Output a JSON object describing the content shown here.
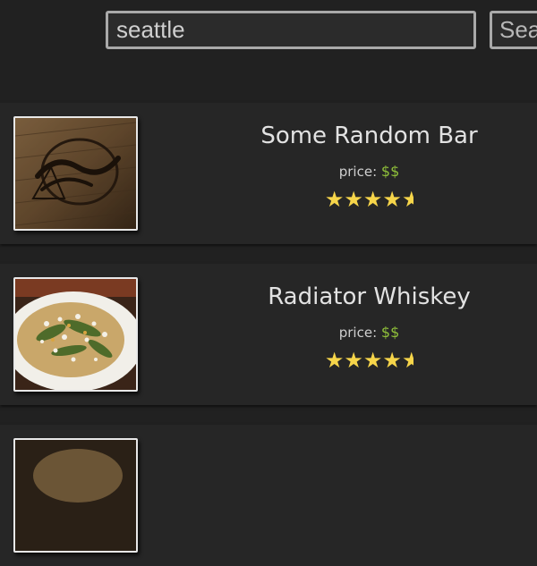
{
  "search": {
    "value": "seattle",
    "button_label": "Search"
  },
  "results": [
    {
      "name": "Some Random Bar",
      "price_label": "price:",
      "price": "$$",
      "rating": 4.5,
      "image": "logo-sign-photo"
    },
    {
      "name": "Radiator Whiskey",
      "price_label": "price:",
      "price": "$$",
      "rating": 4.5,
      "image": "food-dish-photo"
    },
    {
      "image": "food-photo"
    }
  ],
  "colors": {
    "background": "#212121",
    "card": "#262626",
    "price": "#8fbf3a",
    "star": "#f6d54a"
  }
}
